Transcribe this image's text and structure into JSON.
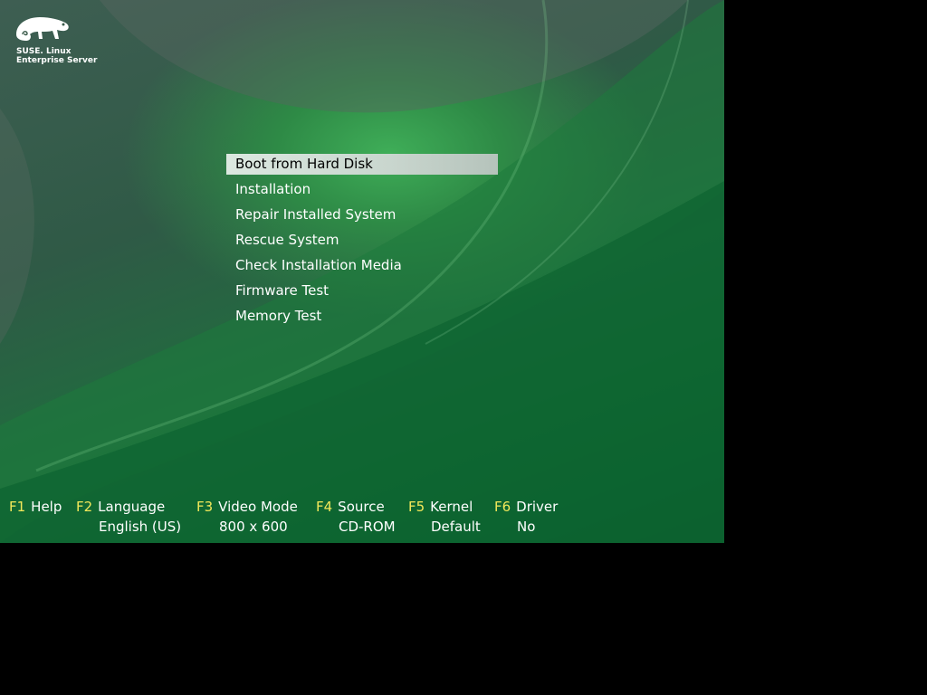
{
  "brand": {
    "line1": "SUSE. Linux",
    "line2": "Enterprise Server",
    "logo_icon": "chameleon-icon"
  },
  "menu": {
    "selected_index": 0,
    "items": [
      {
        "label": "Boot from Hard Disk"
      },
      {
        "label": "Installation"
      },
      {
        "label": "Repair Installed System"
      },
      {
        "label": "Rescue System"
      },
      {
        "label": "Check Installation Media"
      },
      {
        "label": "Firmware Test"
      },
      {
        "label": "Memory Test"
      }
    ]
  },
  "fkeys": {
    "f1": {
      "key": "F1",
      "label": "Help",
      "value": ""
    },
    "f2": {
      "key": "F2",
      "label": "Language",
      "value": "English (US)"
    },
    "f3": {
      "key": "F3",
      "label": "Video Mode",
      "value": "800 x 600"
    },
    "f4": {
      "key": "F4",
      "label": "Source",
      "value": "CD-ROM"
    },
    "f5": {
      "key": "F5",
      "label": "Kernel",
      "value": "Default"
    },
    "f6": {
      "key": "F6",
      "label": "Driver",
      "value": "No"
    }
  },
  "colors": {
    "background_border": "#000000",
    "fkey_color": "#f2e85a",
    "selection_bg": "#d0ddd5",
    "text": "#ffffff"
  }
}
